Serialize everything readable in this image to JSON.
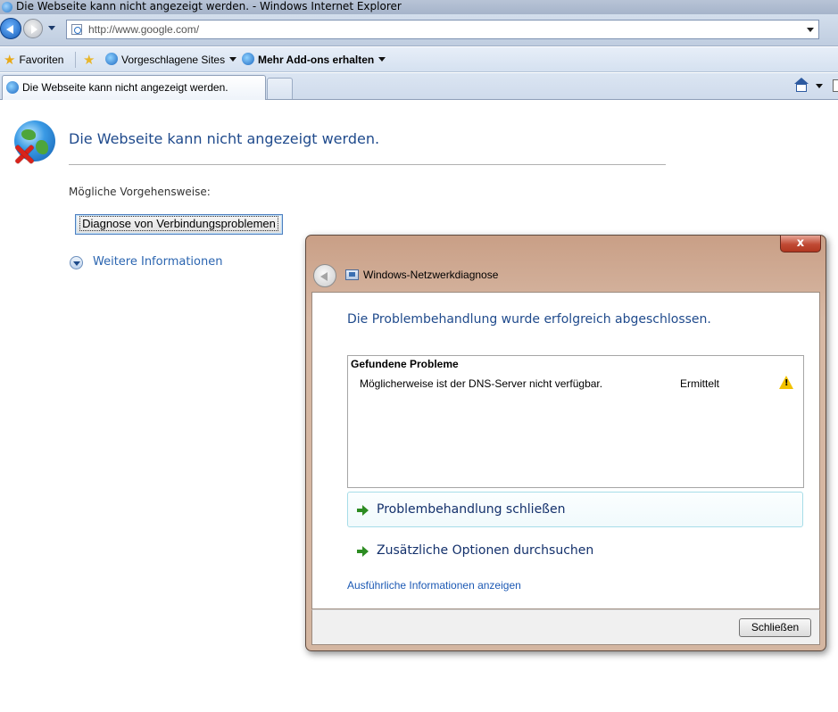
{
  "window": {
    "title": "Die Webseite kann nicht angezeigt werden. - Windows Internet Explorer"
  },
  "address_bar": {
    "url": "http://www.google.com/"
  },
  "favorites_bar": {
    "favorites_label": "Favoriten",
    "suggested_sites_label": "Vorgeschlagene Sites",
    "addons_label": "Mehr Add-ons erhalten"
  },
  "tabs": [
    {
      "label": "Die Webseite kann nicht angezeigt werden."
    }
  ],
  "error_page": {
    "title": "Die Webseite kann nicht angezeigt werden.",
    "subtitle": "Mögliche Vorgehensweise:",
    "diagnose_button": "Diagnose von Verbindungsproblemen",
    "more_info": "Weitere Informationen"
  },
  "dialog": {
    "close_glyph": "x",
    "title": "Windows-Netzwerkdiagnose",
    "headline": "Die Problembehandlung wurde erfolgreich abgeschlossen.",
    "problems": {
      "header": "Gefundene Probleme",
      "rows": [
        {
          "text": "Möglicherweise ist der DNS-Server nicht verfügbar.",
          "status": "Ermittelt",
          "icon": "warning-icon"
        }
      ]
    },
    "actions": [
      {
        "label": "Problembehandlung schließen"
      },
      {
        "label": "Zusätzliche Optionen durchsuchen"
      }
    ],
    "detail_link": "Ausführliche Informationen anzeigen",
    "close_button": "Schließen"
  },
  "colors": {
    "title_blue": "#1f4a8c",
    "link_blue": "#2b65b0",
    "action_green": "#2d8c22",
    "warning_yellow": "#f2c200",
    "dialog_frame": "#d4b6a1"
  }
}
